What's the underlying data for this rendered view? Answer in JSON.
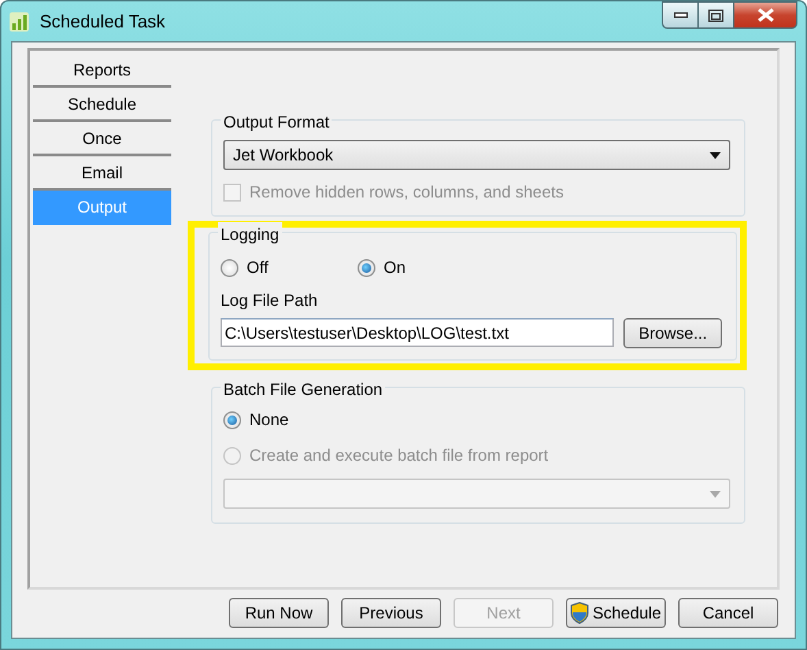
{
  "window": {
    "title": "Scheduled Task"
  },
  "sidebar": {
    "items": [
      {
        "label": "Reports",
        "selected": false
      },
      {
        "label": "Schedule",
        "selected": false
      },
      {
        "label": "Once",
        "selected": false
      },
      {
        "label": "Email",
        "selected": false
      },
      {
        "label": "Output",
        "selected": true
      }
    ]
  },
  "output_format": {
    "title": "Output Format",
    "value": "Jet Workbook",
    "checkbox": {
      "label": "Remove hidden rows, columns, and sheets",
      "checked": false,
      "disabled": true
    }
  },
  "logging": {
    "title": "Logging",
    "highlighted": true,
    "options": [
      {
        "label": "Off",
        "selected": false
      },
      {
        "label": "On",
        "selected": true
      }
    ],
    "path_label": "Log File Path",
    "path_value": "C:\\Users\\testuser\\Desktop\\LOG\\test.txt",
    "browse": "Browse..."
  },
  "batch": {
    "title": "Batch File Generation",
    "options": [
      {
        "label": "None",
        "selected": true,
        "disabled": false
      },
      {
        "label": "Create and execute batch file from report",
        "selected": false,
        "disabled": true
      }
    ],
    "dropdown": {
      "disabled": true
    }
  },
  "buttons": [
    {
      "label": "Run Now",
      "disabled": false,
      "kind": "plain"
    },
    {
      "label": "Previous",
      "disabled": false,
      "kind": "plain"
    },
    {
      "label": "Next",
      "disabled": true,
      "kind": "plain"
    },
    {
      "label": "Schedule",
      "disabled": false,
      "kind": "shield"
    },
    {
      "label": "Cancel",
      "disabled": false,
      "kind": "plain"
    }
  ]
}
